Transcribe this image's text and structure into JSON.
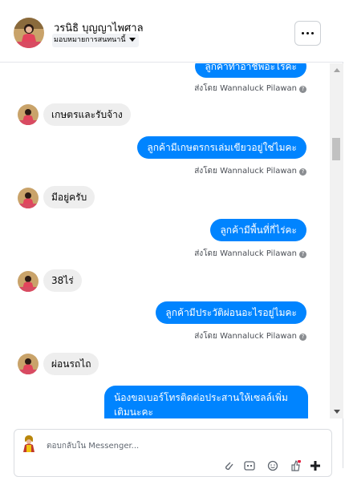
{
  "header": {
    "name": "วรนิธิ บุญญาไพศาล",
    "assign_label": "มอบหมายการสนทนานี้"
  },
  "messages": {
    "m1": {
      "text": "ลูกค้าทำอาชีพอะไรคะ",
      "sent_by": "ส่งโดย Wannaluck Pilawan"
    },
    "m2": {
      "text": "เกษตรและรับจ้าง"
    },
    "m3": {
      "text": "ลูกค้ามีเกษตรกรเล่มเขียวอยู่ใช่ไมคะ",
      "sent_by": "ส่งโดย Wannaluck Pilawan"
    },
    "m4": {
      "text": "มีอยู่ครับ"
    },
    "m5": {
      "text": "ลูกค้ามีพื้นที่กี่ไร่คะ",
      "sent_by": "ส่งโดย Wannaluck Pilawan"
    },
    "m6": {
      "text": "38ไร่"
    },
    "m7": {
      "text": "ลูกค้ามีประวัติผ่อนอะไรอยู่ไมคะ",
      "sent_by": "ส่งโดย Wannaluck Pilawan"
    },
    "m8": {
      "text": "ผ่อนรถไถ"
    },
    "m9": {
      "line1": "น้องขอเบอร์โทรติดต่อประสานให้เซลล์เพิ่ม",
      "line2": "เติมนะคะ"
    }
  },
  "composer": {
    "placeholder": "ตอบกลับใน Messenger..."
  },
  "icons": {
    "more": "more-horizontal-icon",
    "attach": "paperclip-icon",
    "gif": "gif-icon",
    "emoji": "emoji-icon",
    "like": "thumbs-up-icon",
    "add": "plus-icon"
  },
  "colors": {
    "outgoing_bubble": "#0084ff",
    "incoming_bubble": "#eeeeee"
  }
}
